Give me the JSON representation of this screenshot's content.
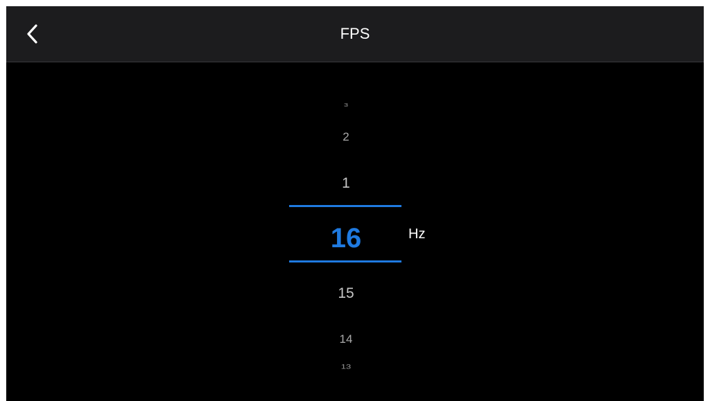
{
  "header": {
    "title": "FPS",
    "back_icon": "chevron-left-icon"
  },
  "picker": {
    "above": [
      "3",
      "2",
      "1"
    ],
    "selected": "16",
    "below": [
      "15",
      "14",
      "13"
    ],
    "unit": "Hz"
  },
  "colors": {
    "accent": "#1f7ae0",
    "background": "#000000",
    "header_bg": "#1c1c1e"
  }
}
